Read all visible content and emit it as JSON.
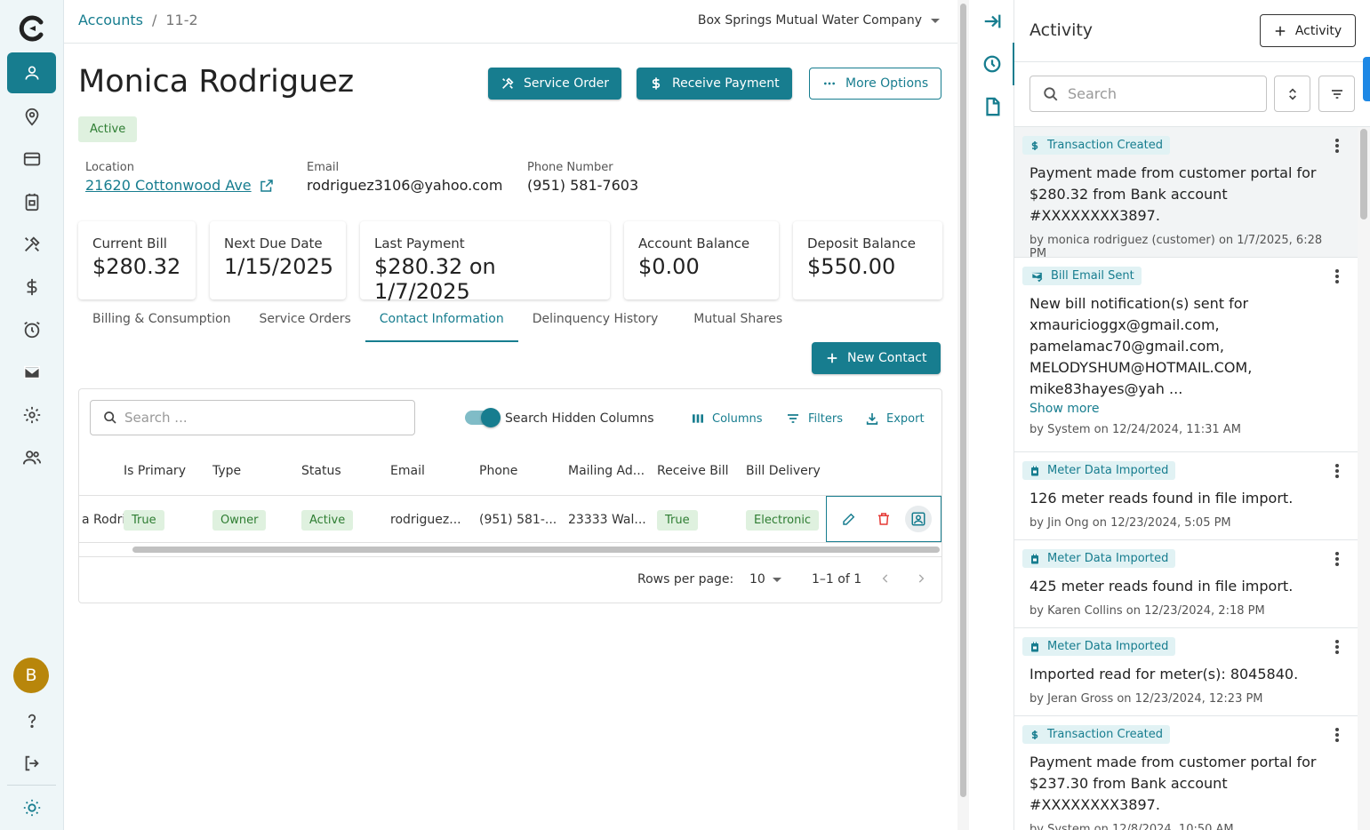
{
  "breadcrumb": {
    "root": "Accounts",
    "separator": "/",
    "current": "11-2"
  },
  "company": "Box Springs Mutual Water Company",
  "customer": {
    "name": "Monica Rodriguez",
    "status": "Active",
    "location_label": "Location",
    "location": "21620 Cottonwood Ave",
    "email_label": "Email",
    "email": "rodriguez3106@yahoo.com",
    "phone_label": "Phone Number",
    "phone": "(951) 581-7603"
  },
  "actions": {
    "service_order": "Service Order",
    "receive_payment": "Receive Payment",
    "more_options": "More Options"
  },
  "cards": [
    {
      "label": "Current Bill",
      "value": "$280.32"
    },
    {
      "label": "Next Due Date",
      "value": "1/15/2025"
    },
    {
      "label": "Last Payment",
      "value": "$280.32 on 1/7/2025"
    },
    {
      "label": "Account Balance",
      "value": "$0.00"
    },
    {
      "label": "Deposit Balance",
      "value": "$550.00"
    }
  ],
  "tabs": [
    "Billing & Consumption",
    "Service Orders",
    "Contact Information",
    "Delinquency History",
    "Mutual Shares"
  ],
  "active_tab": "Contact Information",
  "new_contact": "New Contact",
  "grid": {
    "search_placeholder": "Search ...",
    "search_hidden": "Search Hidden Columns",
    "columns_label": "Columns",
    "filters_label": "Filters",
    "export_label": "Export",
    "headers": [
      "ct",
      "Is Primary",
      "Type",
      "Status",
      "Email",
      "Phone",
      "Mailing Ad...",
      "Receive Bill",
      "Bill Delivery"
    ],
    "row": {
      "contact": "a Rodri",
      "is_primary": "True",
      "type": "Owner",
      "status": "Active",
      "email": "rodriguez...",
      "phone": "(951) 581-...",
      "mailing": "23333 Wal...",
      "receive_bill": "True",
      "bill_delivery": "Electronic"
    },
    "rows_per_page_label": "Rows per page:",
    "rows_per_page": "10",
    "range": "1–1 of 1"
  },
  "user_initial": "B",
  "activity": {
    "title": "Activity",
    "add_label": "Activity",
    "search_placeholder": "Search",
    "entries": [
      {
        "type": "Transaction Created",
        "text": "Payment made from customer portal for $280.32 from Bank account #XXXXXXXX3897.",
        "meta": "by monica rodriguez (customer) on 1/7/2025, 6:28 PM"
      },
      {
        "type": "Bill Email Sent",
        "text": "New bill notification(s) sent for xmauricioggx@gmail.com, pamelamac70@gmail.com, MELODYSHUM@HOTMAIL.COM, mike83hayes@yah ...",
        "more": "Show more",
        "meta": "by System on 12/24/2024, 11:31 AM"
      },
      {
        "type": "Meter Data Imported",
        "text": "126 meter reads found in file import.",
        "meta": "by Jin Ong on 12/23/2024, 5:05 PM"
      },
      {
        "type": "Meter Data Imported",
        "text": "425 meter reads found in file import.",
        "meta": "by Karen Collins on 12/23/2024, 2:18 PM"
      },
      {
        "type": "Meter Data Imported",
        "text": "Imported read for meter(s): 8045840.",
        "meta": "by Jeran Gross on 12/23/2024, 12:23 PM"
      },
      {
        "type": "Transaction Created",
        "text": "Payment made from customer portal for $237.30 from Bank account #XXXXXXXX3897.",
        "meta": "by System on 12/8/2024, 10:50 AM"
      }
    ]
  },
  "colors": {
    "accent": "#177d8f",
    "chip_green_bg": "#dff1df",
    "chip_green_text": "#2e7d32",
    "avatar": "#b8860b"
  }
}
